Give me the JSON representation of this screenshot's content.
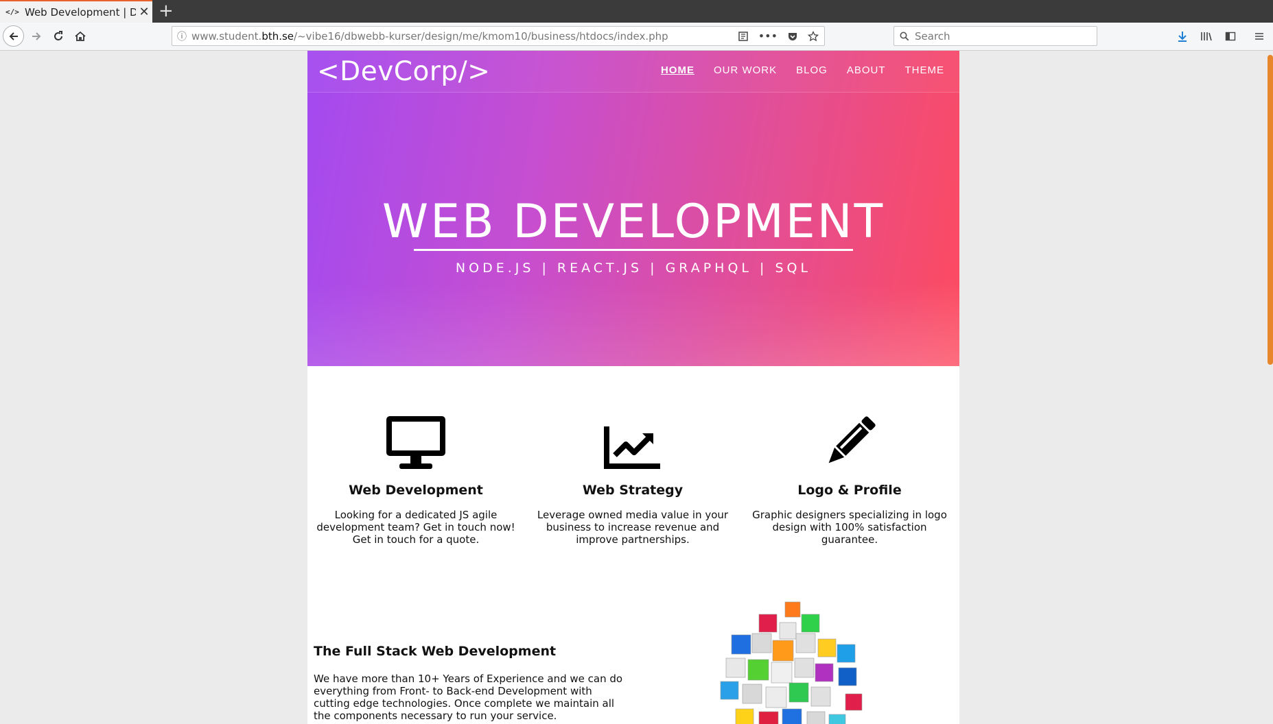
{
  "browser": {
    "tab_title": "Web Development | Dev",
    "tab_favicon": "</>",
    "url_prefix": "www.student.",
    "url_domain": "bth.se",
    "url_path": "/~vibe16/dbwebb-kurser/design/me/kmom10/business/htdocs/index.php",
    "search_placeholder": "Search",
    "accent": "#e8602c"
  },
  "site": {
    "logo": "<DevCorp/>",
    "nav": [
      {
        "label": "HOME"
      },
      {
        "label": "OUR WORK"
      },
      {
        "label": "BLOG"
      },
      {
        "label": "ABOUT"
      },
      {
        "label": "THEME"
      }
    ],
    "hero": {
      "title": "WEB DEVELOPMENT",
      "subtitle": "NODE.JS | REACT.JS | GRAPHQL | SQL",
      "gradient_start": "#a34af0",
      "gradient_end": "#fd4a5f"
    },
    "features": [
      {
        "icon": "desktop-monitor-icon",
        "title": "Web Development",
        "text": "Looking for a dedicated JS agile development team? Get in touch now! Get in touch for a quote."
      },
      {
        "icon": "line-chart-icon",
        "title": "Web Strategy",
        "text": "Leverage owned media value in your business to increase revenue and improve partnerships."
      },
      {
        "icon": "pencil-icon",
        "title": "Logo & Profile",
        "text": "Graphic designers specializing in logo design with 100% satisfaction guarantee."
      }
    ],
    "fullstack": {
      "title": "The Full Stack Web Development",
      "text": "We have more than 10+ Years of Experience and we can do everything from Front- to Back-end Development with cutting edge technologies. Once complete we maintain all the components necessary to run your service."
    }
  }
}
